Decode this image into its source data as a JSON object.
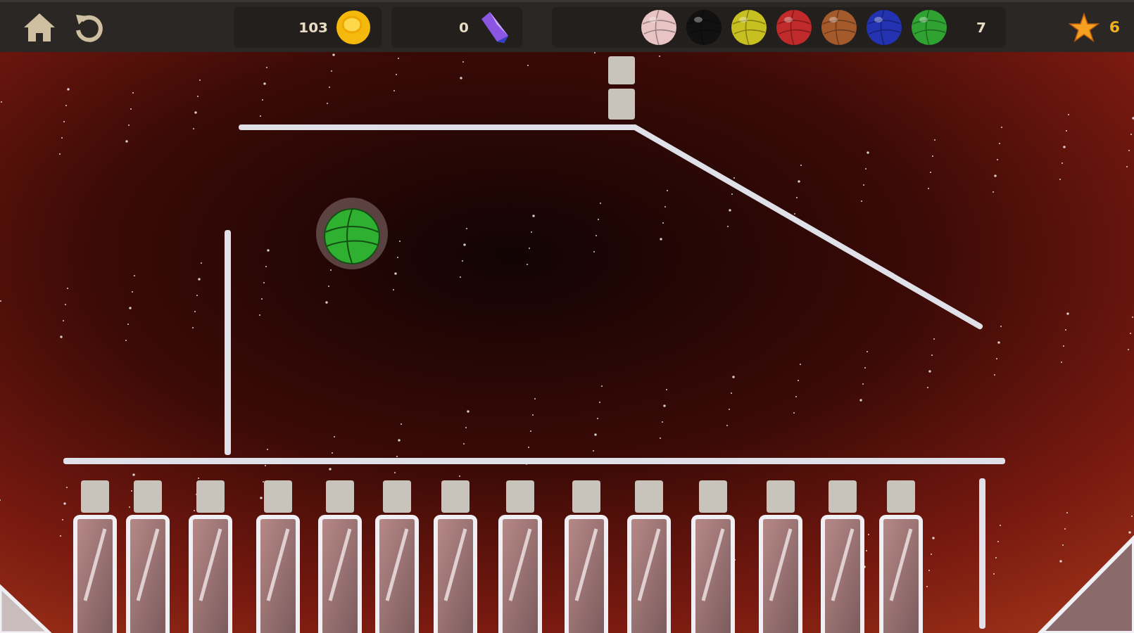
{
  "top_bar": {
    "coins": "103",
    "gems": "0",
    "balls": [
      {
        "color": "#e8c4c4"
      },
      {
        "color": "#111111"
      },
      {
        "color": "#c8c020"
      },
      {
        "color": "#c02a2a"
      },
      {
        "color": "#a55a2c"
      },
      {
        "color": "#2232b0"
      },
      {
        "color": "#2fa232"
      }
    ],
    "balls_count": "7",
    "stars": "6"
  }
}
